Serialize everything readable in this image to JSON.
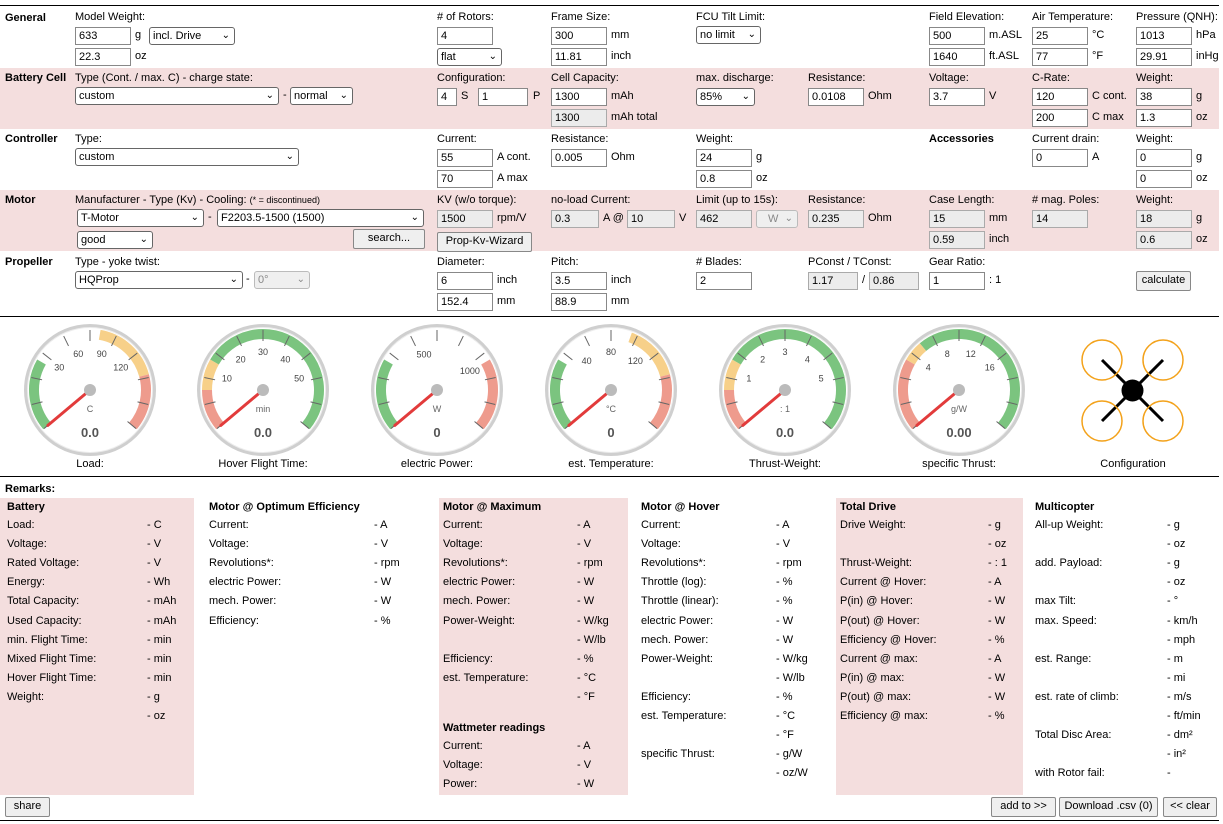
{
  "general": {
    "title": "General",
    "model_weight_label": "Model Weight:",
    "weight_g": "633",
    "unit_g": "g",
    "weight_mode": "incl. Drive",
    "weight_oz": "22.3",
    "unit_oz": "oz",
    "rotors_label": "# of Rotors:",
    "rotors": "4",
    "rotor_layout": "flat",
    "frame_label": "Frame Size:",
    "frame_mm": "300",
    "unit_mm": "mm",
    "frame_inch": "11.81",
    "unit_inch": "inch",
    "fcu_label": "FCU Tilt Limit:",
    "fcu_value": "no limit",
    "elev_label": "Field Elevation:",
    "elev_m": "500",
    "unit_masl": "m.ASL",
    "elev_ft": "1640",
    "unit_ftasl": "ft.ASL",
    "air_label": "Air Temperature:",
    "air_c": "25",
    "unit_c": "°C",
    "air_f": "77",
    "unit_f": "°F",
    "press_label": "Pressure (QNH):",
    "press_hpa": "1013",
    "unit_hpa": "hPa",
    "press_inhg": "29.91",
    "unit_inhg": "inHg"
  },
  "battery": {
    "title": "Battery Cell",
    "type_label": "Type (Cont. / max. C) - charge state:",
    "type_value": "custom",
    "dash": "-",
    "charge_state": "normal",
    "config_label": "Configuration:",
    "cells_s": "4",
    "unit_s": "S",
    "cells_p": "1",
    "unit_p": "P",
    "capacity_label": "Cell Capacity:",
    "capacity": "1300",
    "unit_mah": "mAh",
    "capacity_total": "1300",
    "unit_mah_total": "mAh total",
    "maxdis_label": "max. discharge:",
    "maxdis": "85%",
    "res_label": "Resistance:",
    "res": "0.0108",
    "unit_ohm": "Ohm",
    "volt_label": "Voltage:",
    "volt": "3.7",
    "unit_v": "V",
    "crate_label": "C-Rate:",
    "c_cont": "120",
    "unit_ccont": "C cont.",
    "c_max": "200",
    "unit_cmax": "C max",
    "weight_label": "Weight:",
    "weight_g": "38",
    "unit_g": "g",
    "weight_oz": "1.3",
    "unit_oz": "oz"
  },
  "controller": {
    "title": "Controller",
    "type_label": "Type:",
    "type_value": "custom",
    "current_label": "Current:",
    "current_cont": "55",
    "unit_acont": "A cont.",
    "current_max": "70",
    "unit_amax": "A max",
    "res_label": "Resistance:",
    "res": "0.005",
    "unit_ohm": "Ohm",
    "weight_label": "Weight:",
    "weight_g": "24",
    "unit_g": "g",
    "weight_oz": "0.8",
    "unit_oz": "oz",
    "acc_title": "Accessories",
    "drain_label": "Current drain:",
    "drain": "0",
    "unit_a": "A",
    "acc_weight_label": "Weight:",
    "acc_weight_g": "0",
    "acc_unit_g": "g",
    "acc_weight_oz": "0",
    "acc_unit_oz": "oz"
  },
  "motor": {
    "title": "Motor",
    "mfr_label": "Manufacturer - Type (Kv) - Cooling:",
    "mfr_note": "(* = discontinued)",
    "manufacturer": "T-Motor",
    "dash": "-",
    "motor_type": "F2203.5-1500 (1500)",
    "cooling": "good",
    "search": "search...",
    "kv_label": "KV (w/o torque):",
    "kv": "1500",
    "unit_kv": "rpm/V",
    "wizard": "Prop-Kv-Wizard",
    "noload_label": "no-load Current:",
    "noload_a": "0.3",
    "unit_a_at": "A @",
    "noload_v": "10",
    "unit_v": "V",
    "limit_label": "Limit (up to 15s):",
    "limit": "462",
    "limit_unit": "W",
    "res_label": "Resistance:",
    "res": "0.235",
    "unit_ohm": "Ohm",
    "case_label": "Case Length:",
    "case_mm": "15",
    "unit_mm": "mm",
    "case_inch": "0.59",
    "unit_inch": "inch",
    "poles_label": "# mag. Poles:",
    "poles": "14",
    "weight_label": "Weight:",
    "weight_g": "18",
    "unit_g": "g",
    "weight_oz": "0.6",
    "unit_oz": "oz"
  },
  "propeller": {
    "title": "Propeller",
    "type_label": "Type - yoke twist:",
    "type_value": "HQProp",
    "dash": "-",
    "twist": "0°",
    "diam_label": "Diameter:",
    "diam_inch": "6",
    "unit_inch": "inch",
    "diam_mm": "152.4",
    "unit_mm": "mm",
    "pitch_label": "Pitch:",
    "pitch_inch": "3.5",
    "pitch_unit_inch": "inch",
    "pitch_mm": "88.9",
    "pitch_unit_mm": "mm",
    "blades_label": "# Blades:",
    "blades": "2",
    "pconst_label": "PConst / TConst:",
    "pconst": "1.17",
    "slash": "/",
    "tconst": "0.86",
    "gear_label": "Gear Ratio:",
    "gear": "1",
    "gear_unit": ": 1",
    "calculate": "calculate"
  },
  "gauges": [
    {
      "label": "Load:",
      "unit": "C",
      "value": "0.0",
      "ticks": [
        "30",
        "60",
        "90",
        "120"
      ]
    },
    {
      "label": "Hover Flight Time:",
      "unit": "min",
      "value": "0.0",
      "ticks": [
        "10",
        "20",
        "30",
        "40",
        "50"
      ]
    },
    {
      "label": "electric Power:",
      "unit": "W",
      "value": "0",
      "ticks": [
        "500",
        "1000"
      ]
    },
    {
      "label": "est. Temperature:",
      "unit": "°C",
      "value": "0",
      "ticks": [
        "40",
        "80",
        "120"
      ]
    },
    {
      "label": "Thrust-Weight:",
      "unit": ": 1",
      "value": "0.0",
      "ticks": [
        "1",
        "2",
        "3",
        "4",
        "5"
      ]
    },
    {
      "label": "specific Thrust:",
      "unit": "g/W",
      "value": "0.00",
      "ticks": [
        "4",
        "8",
        "12",
        "16"
      ]
    }
  ],
  "configuration_label": "Configuration",
  "remarks": {
    "title": "Remarks:",
    "battery": {
      "title": "Battery",
      "rows": [
        [
          "Load:",
          "- C"
        ],
        [
          "Voltage:",
          "- V"
        ],
        [
          "Rated Voltage:",
          "- V"
        ],
        [
          "Energy:",
          "- Wh"
        ],
        [
          "Total Capacity:",
          "- mAh"
        ],
        [
          "Used Capacity:",
          "- mAh"
        ],
        [
          "min. Flight Time:",
          "- min"
        ],
        [
          "Mixed Flight Time:",
          "- min"
        ],
        [
          "Hover Flight Time:",
          "- min"
        ],
        [
          "Weight:",
          "- g"
        ],
        [
          "",
          "- oz"
        ]
      ]
    },
    "opt": {
      "title": "Motor @ Optimum Efficiency",
      "rows": [
        [
          "Current:",
          "- A"
        ],
        [
          "Voltage:",
          "- V"
        ],
        [
          "Revolutions*:",
          "- rpm"
        ],
        [
          "electric Power:",
          "- W"
        ],
        [
          "mech. Power:",
          "- W"
        ],
        [
          "Efficiency:",
          "- %"
        ]
      ]
    },
    "max": {
      "title": "Motor @ Maximum",
      "rows": [
        [
          "Current:",
          "- A"
        ],
        [
          "Voltage:",
          "- V"
        ],
        [
          "Revolutions*:",
          "- rpm"
        ],
        [
          "electric Power:",
          "- W"
        ],
        [
          "mech. Power:",
          "- W"
        ],
        [
          "Power-Weight:",
          "- W/kg"
        ],
        [
          "",
          "- W/lb"
        ],
        [
          "Efficiency:",
          "- %"
        ],
        [
          "est. Temperature:",
          "- °C"
        ],
        [
          "",
          "- °F"
        ]
      ]
    },
    "watt": {
      "title": "Wattmeter readings",
      "rows": [
        [
          "Current:",
          "- A"
        ],
        [
          "Voltage:",
          "- V"
        ],
        [
          "Power:",
          "- W"
        ]
      ]
    },
    "hover": {
      "title": "Motor @ Hover",
      "rows": [
        [
          "Current:",
          "- A"
        ],
        [
          "Voltage:",
          "- V"
        ],
        [
          "Revolutions*:",
          "- rpm"
        ],
        [
          "Throttle (log):",
          "- %"
        ],
        [
          "Throttle (linear):",
          "- %"
        ],
        [
          "electric Power:",
          "- W"
        ],
        [
          "mech. Power:",
          "- W"
        ],
        [
          "Power-Weight:",
          "- W/kg"
        ],
        [
          "",
          "- W/lb"
        ],
        [
          "Efficiency:",
          "- %"
        ],
        [
          "est. Temperature:",
          "- °C"
        ],
        [
          "",
          "- °F"
        ],
        [
          "specific Thrust:",
          "- g/W"
        ],
        [
          "",
          "- oz/W"
        ]
      ]
    },
    "drive": {
      "title": "Total Drive",
      "rows": [
        [
          "Drive Weight:",
          "- g"
        ],
        [
          "",
          "- oz"
        ],
        [
          "Thrust-Weight:",
          "- : 1"
        ],
        [
          "Current @ Hover:",
          "- A"
        ],
        [
          "P(in) @ Hover:",
          "- W"
        ],
        [
          "P(out) @ Hover:",
          "- W"
        ],
        [
          "Efficiency @ Hover:",
          "- %"
        ],
        [
          "Current @ max:",
          "- A"
        ],
        [
          "P(in) @ max:",
          "- W"
        ],
        [
          "P(out) @ max:",
          "- W"
        ],
        [
          "Efficiency @ max:",
          "- %"
        ]
      ]
    },
    "multi": {
      "title": "Multicopter",
      "rows": [
        [
          "All-up Weight:",
          "- g"
        ],
        [
          "",
          "- oz"
        ],
        [
          "add. Payload:",
          "- g"
        ],
        [
          "",
          "- oz"
        ],
        [
          "max Tilt:",
          "- °"
        ],
        [
          "max. Speed:",
          "- km/h"
        ],
        [
          "",
          "- mph"
        ],
        [
          "est. Range:",
          "- m"
        ],
        [
          "",
          "- mi"
        ],
        [
          "est. rate of climb:",
          "- m/s"
        ],
        [
          "",
          "- ft/min"
        ],
        [
          "Total Disc Area:",
          "- dm²"
        ],
        [
          "",
          "- in²"
        ],
        [
          "with Rotor fail:",
          "-"
        ]
      ]
    }
  },
  "footer": {
    "share": "share",
    "add_to": "add to >>",
    "download": "Download .csv (0)",
    "clear": "<< clear"
  }
}
